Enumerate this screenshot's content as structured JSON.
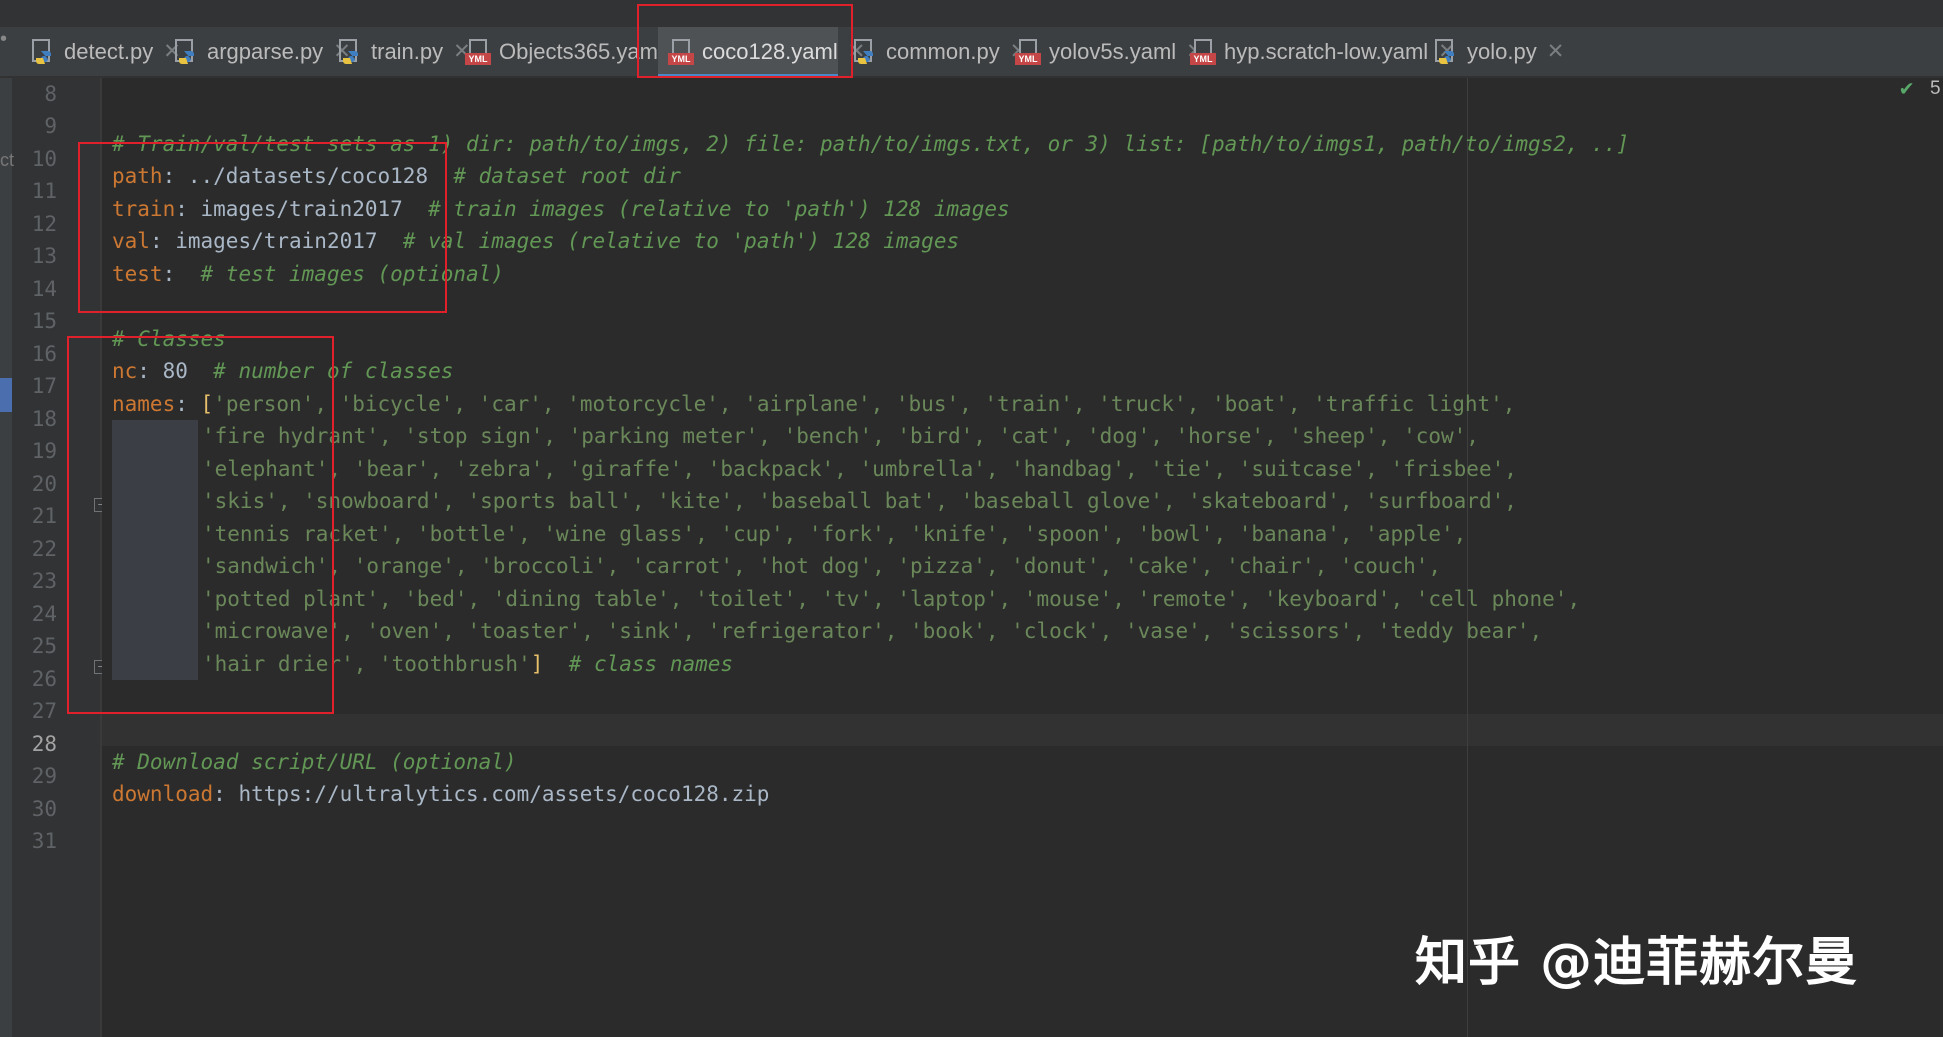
{
  "tabs": [
    {
      "label": "detect.py",
      "icon": "python-file-icon"
    },
    {
      "label": "argparse.py",
      "icon": "python-file-icon"
    },
    {
      "label": "train.py",
      "icon": "python-file-icon"
    },
    {
      "label": "Objects365.yaml",
      "icon": "yaml-file-icon"
    },
    {
      "label": "coco128.yaml",
      "icon": "yaml-file-icon",
      "active": true
    },
    {
      "label": "common.py",
      "icon": "python-file-icon"
    },
    {
      "label": "yolov5s.yaml",
      "icon": "yaml-file-icon"
    },
    {
      "label": "hyp.scratch-low.yaml",
      "icon": "yaml-file-icon"
    },
    {
      "label": "yolo.py",
      "icon": "python-file-icon"
    }
  ],
  "yaml_icon_text": "YML",
  "close_glyph": "✕",
  "left_edge": {
    "top_fragment": "•",
    "side_fragment": "ct"
  },
  "inspection": {
    "icon": "check-icon",
    "count": "5"
  },
  "line_numbers": [
    "8",
    "9",
    "10",
    "11",
    "12",
    "13",
    "14",
    "15",
    "16",
    "17",
    "18",
    "19",
    "20",
    "21",
    "22",
    "23",
    "24",
    "25",
    "26",
    "27",
    "28",
    "29",
    "30",
    "31"
  ],
  "current_line": "28",
  "code": {
    "l10_comment": "# Train/val/test sets as 1) dir: path/to/imgs, 2) file: path/to/imgs.txt, or 3) list: [path/to/imgs1, path/to/imgs2, ..]",
    "l11_key": "path",
    "l11_value": ": ../datasets/coco128  ",
    "l11_comment": "# dataset root dir",
    "l12_key": "train",
    "l12_value": ": images/train2017  ",
    "l12_comment": "# train images (relative to 'path') 128 images",
    "l13_key": "val",
    "l13_value": ": images/train2017  ",
    "l13_comment": "# val images (relative to 'path') 128 images",
    "l14_key": "test",
    "l14_value": ":  ",
    "l14_comment": "# test images (optional)",
    "l16_comment": "# Classes",
    "l17_key": "nc",
    "l17_value": ": 80  ",
    "l17_comment": "# number of classes",
    "l18_key": "names",
    "l18_value": ": ",
    "open_bracket": "[",
    "close_bracket": "]",
    "l18_list": "'person', 'bicycle', 'car', 'motorcycle', 'airplane', 'bus', 'train', 'truck', 'boat', 'traffic light',",
    "l19_list": "'fire hydrant', 'stop sign', 'parking meter', 'bench', 'bird', 'cat', 'dog', 'horse', 'sheep', 'cow',",
    "l20_list": "'elephant', 'bear', 'zebra', 'giraffe', 'backpack', 'umbrella', 'handbag', 'tie', 'suitcase', 'frisbee',",
    "l21_list": "'skis', 'snowboard', 'sports ball', 'kite', 'baseball bat', 'baseball glove', 'skateboard', 'surfboard',",
    "l22_list": "'tennis racket', 'bottle', 'wine glass', 'cup', 'fork', 'knife', 'spoon', 'bowl', 'banana', 'apple',",
    "l23_list": "'sandwich', 'orange', 'broccoli', 'carrot', 'hot dog', 'pizza', 'donut', 'cake', 'chair', 'couch',",
    "l24_list": "'potted plant', 'bed', 'dining table', 'toilet', 'tv', 'laptop', 'mouse', 'remote', 'keyboard', 'cell phone',",
    "l25_list": "'microwave', 'oven', 'toaster', 'sink', 'refrigerator', 'book', 'clock', 'vase', 'scissors', 'teddy bear',",
    "l26_list": "'hair drier', 'toothbrush'",
    "l26_tail": "  ",
    "l26_comment": "# class names",
    "l29_comment": "# Download script/URL (optional)",
    "l30_key": "download",
    "l30_value": ": https://ultralytics.com/assets/coco128.zip"
  },
  "watermark": "知乎 @迪菲赫尔曼",
  "colors": {
    "keyword": "#cc7832",
    "comment": "#629755",
    "string": "#6a8759",
    "bracket": "#e8bf6a",
    "annotation": "#e0202a",
    "active_tab_underline": "#4a88c7"
  }
}
